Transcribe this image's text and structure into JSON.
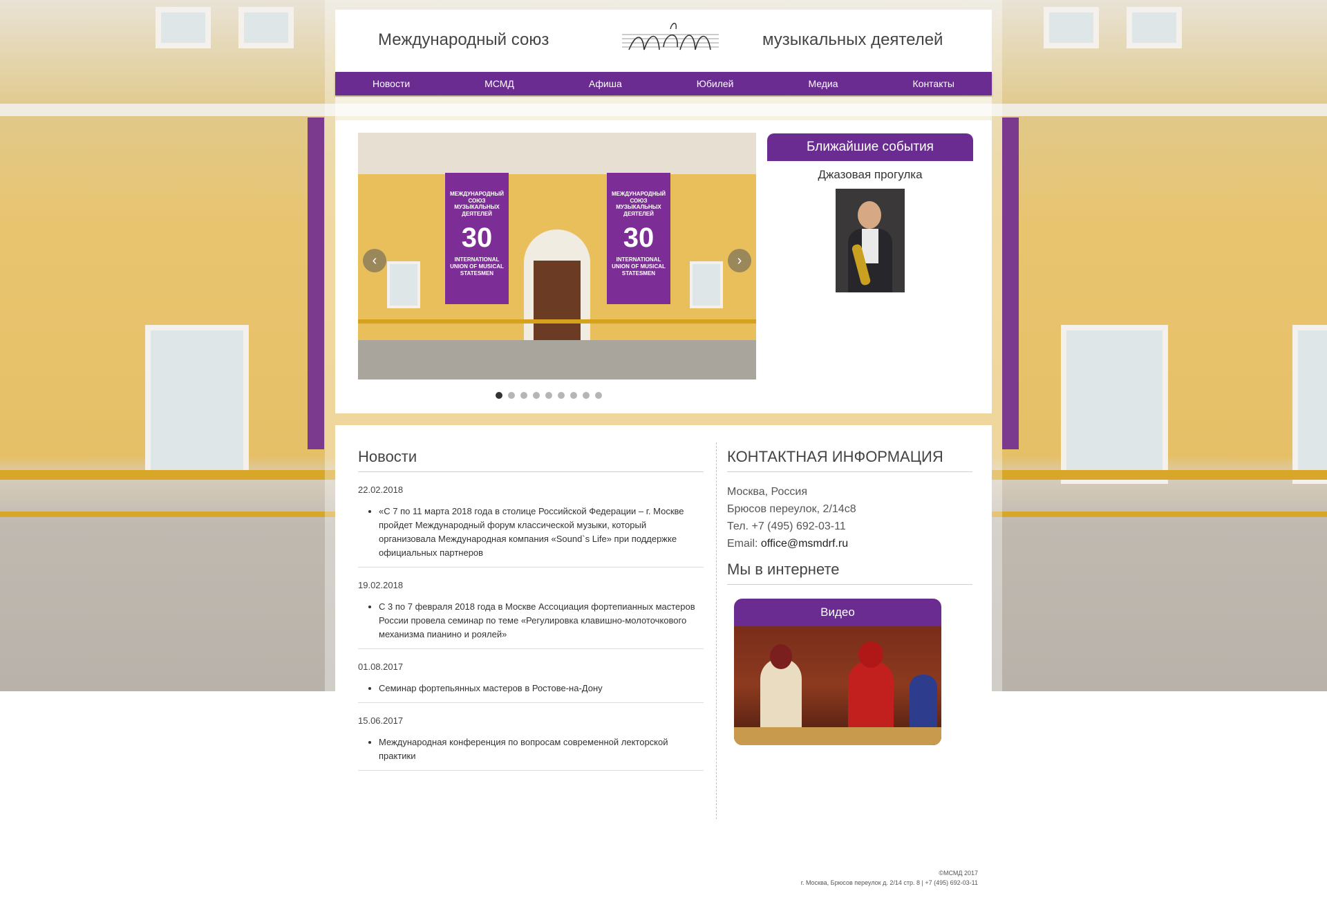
{
  "header": {
    "left_title": "Международный союз",
    "right_title": "музыкальных деятелей",
    "logo_text": "МСМД"
  },
  "nav": {
    "items": [
      "Новости",
      "МСМД",
      "Афиша",
      "Юбилей",
      "Медиа",
      "Контакты"
    ]
  },
  "slider": {
    "banner_top": "МЕЖДУНАРОДНЫЙ СОЮЗ МУЗЫКАЛЬНЫХ ДЕЯТЕЛЕЙ",
    "banner_number": "30",
    "banner_caption": "INTERNATIONAL UNION OF MUSICAL STATESMEN",
    "prev_label": "‹",
    "next_label": "›",
    "slide_count": 9,
    "active_index": 0
  },
  "events": {
    "title": "Ближайшие события",
    "event_name": "Джазовая прогулка"
  },
  "news": {
    "title": "Новости",
    "items": [
      {
        "date": "22.02.2018",
        "text": "«С 7 по 11 марта 2018 года в столице Российской Федерации – г. Москве пройдет Международный форум классической музыки, который организовала Международная компания «Sound`s Life» при поддержке официальных партнеров"
      },
      {
        "date": "19.02.2018",
        "text": "С 3 по 7 февраля 2018 года в Москве Ассоциация фортепианных мастеров России провела семинар по теме «Регулировка клавишно-молоточкового механизма пианино и роялей»"
      },
      {
        "date": "01.08.2017",
        "text": "Семинар фортепьянных мастеров в Ростове-на-Дону"
      },
      {
        "date": "15.06.2017",
        "text": "Международная конференция по вопросам современной лекторской практики"
      }
    ]
  },
  "contacts": {
    "title": "КОНТАКТНАЯ ИНФОРМАЦИЯ",
    "city": "Москва, Россия",
    "address": "Брюсов переулок, 2/14с8",
    "phone": "Тел. +7 (495) 692-03-11",
    "email_label": "Email: ",
    "email": "office@msmdrf.ru",
    "web_title": "Мы в интернете",
    "video_label": "Видео"
  },
  "footer": {
    "copyright": "©МСМД 2017",
    "address_line": "г. Москва, Брюсов переулок д. 2/14 стр. 8 | +7 (495) 692-03-11"
  },
  "colors": {
    "accent": "#6b2c91",
    "text": "#444444"
  }
}
